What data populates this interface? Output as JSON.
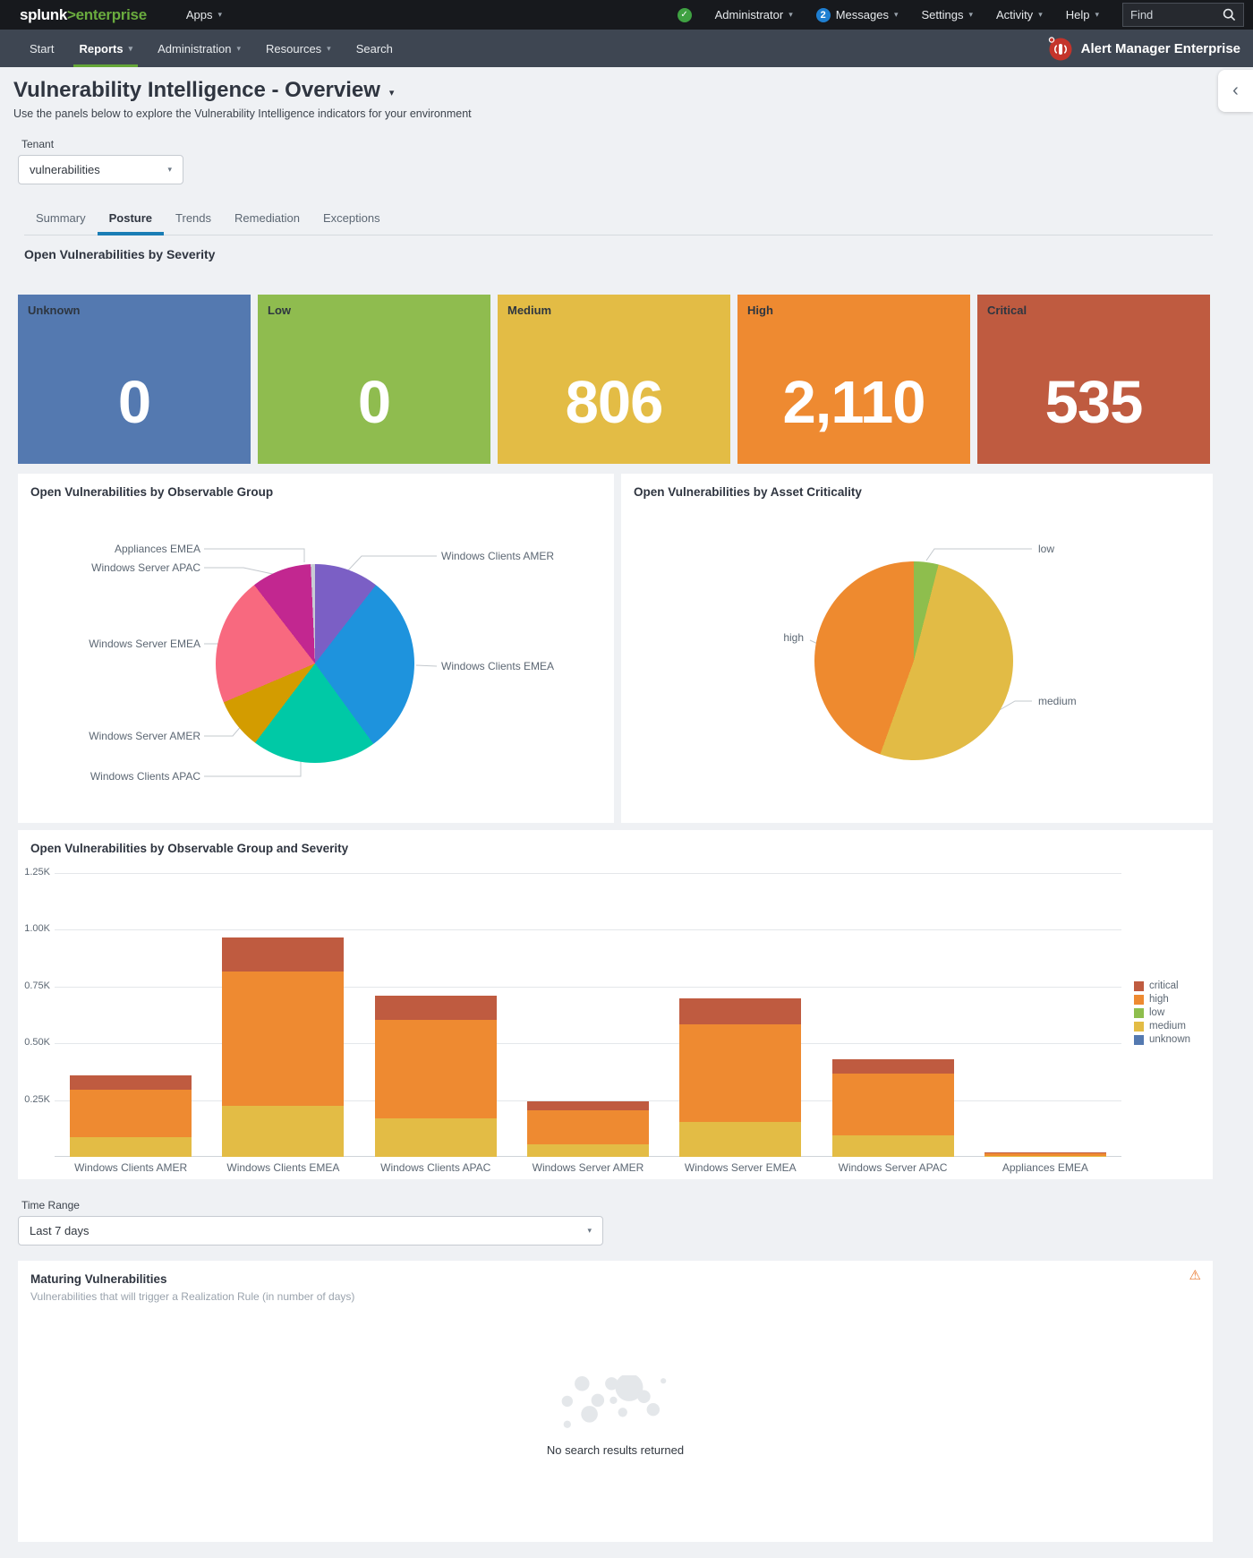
{
  "icons": {
    "caret_down": "▾",
    "chevron_left": "‹",
    "check": "✓",
    "warning": "⚠"
  },
  "topnav": {
    "logo_splunk": "splunk",
    "logo_gt": ">",
    "logo_product": "enterprise",
    "apps": "Apps",
    "administrator": "Administrator",
    "messages_badge": "2",
    "messages": "Messages",
    "settings": "Settings",
    "activity": "Activity",
    "help": "Help",
    "find_placeholder": "Find"
  },
  "appnav": {
    "items": [
      "Start",
      "Reports",
      "Administration",
      "Resources",
      "Search"
    ],
    "active": "Reports",
    "app_name": "Alert Manager Enterprise"
  },
  "page": {
    "title": "Vulnerability Intelligence - Overview",
    "subtitle": "Use the panels below to explore the Vulnerability Intelligence indicators for your environment",
    "tenant_label": "Tenant",
    "tenant_value": "vulnerabilities",
    "time_range_label": "Time Range",
    "time_range_value": "Last 7 days"
  },
  "tabs": {
    "items": [
      "Summary",
      "Posture",
      "Trends",
      "Remediation",
      "Exceptions"
    ],
    "active": "Posture"
  },
  "severity_section": {
    "heading": "Open Vulnerabilities by Severity",
    "tiles": [
      {
        "label": "Unknown",
        "value": "0",
        "color": "#5479b0"
      },
      {
        "label": "Low",
        "value": "0",
        "color": "#8fbc4f"
      },
      {
        "label": "Medium",
        "value": "806",
        "color": "#e3bc45"
      },
      {
        "label": "High",
        "value": "2,110",
        "color": "#ee8a31"
      },
      {
        "label": "Critical",
        "value": "535",
        "color": "#bf5b40"
      }
    ]
  },
  "chart_data": [
    {
      "type": "pie",
      "title": "Open Vulnerabilities by Observable Group",
      "legend_position": "callout-labels",
      "slices": [
        {
          "label": "Windows Clients AMER",
          "percent": 10.5,
          "color": "#7b5fc5"
        },
        {
          "label": "Windows Clients EMEA",
          "percent": 29.5,
          "color": "#1e93dd"
        },
        {
          "label": "Windows Clients APAC",
          "percent": 20.3,
          "color": "#00c9a6"
        },
        {
          "label": "Windows Server AMER",
          "percent": 8.3,
          "color": "#d39c00"
        },
        {
          "label": "Windows Server EMEA",
          "percent": 20.9,
          "color": "#f8697f"
        },
        {
          "label": "Windows Server APAC",
          "percent": 9.8,
          "color": "#c22790"
        },
        {
          "label": "Appliances EMEA",
          "percent": 0.7,
          "color": "#c8cdd4"
        }
      ]
    },
    {
      "type": "pie",
      "title": "Open Vulnerabilities by Asset Criticality",
      "legend_position": "callout-labels",
      "slices": [
        {
          "label": "low",
          "percent": 4.0,
          "color": "#8ebe4d"
        },
        {
          "label": "medium",
          "percent": 51.5,
          "color": "#e2bb45"
        },
        {
          "label": "high",
          "percent": 44.5,
          "color": "#ee8a2f"
        }
      ]
    },
    {
      "type": "stacked-bar",
      "title": "Open Vulnerabilities by Observable Group and Severity",
      "categories": [
        "Windows Clients AMER",
        "Windows Clients EMEA",
        "Windows Clients APAC",
        "Windows Server AMER",
        "Windows Server EMEA",
        "Windows Server APAC",
        "Appliances EMEA"
      ],
      "series": [
        {
          "name": "medium",
          "color": "#e3bc45",
          "values": [
            85,
            225,
            170,
            55,
            155,
            95,
            5
          ]
        },
        {
          "name": "high",
          "color": "#ee8a31",
          "values": [
            210,
            590,
            435,
            150,
            430,
            270,
            10
          ]
        },
        {
          "name": "critical",
          "color": "#bf5b40",
          "values": [
            65,
            150,
            105,
            40,
            115,
            65,
            5
          ]
        }
      ],
      "legend": [
        {
          "name": "critical",
          "color": "#bf5b40"
        },
        {
          "name": "high",
          "color": "#ee8a31"
        },
        {
          "name": "low",
          "color": "#8ebe4d"
        },
        {
          "name": "medium",
          "color": "#e3bc45"
        },
        {
          "name": "unknown",
          "color": "#5479b0"
        }
      ],
      "yticks": [
        {
          "label": "1.25K",
          "value": 1250
        },
        {
          "label": "1.00K",
          "value": 1000
        },
        {
          "label": "0.75K",
          "value": 750
        },
        {
          "label": "0.50K",
          "value": 500
        },
        {
          "label": "0.25K",
          "value": 250
        }
      ],
      "ylim": [
        0,
        1250
      ],
      "grid": true,
      "legend_position": "right"
    }
  ],
  "maturing": {
    "title": "Maturing Vulnerabilities",
    "subtitle": "Vulnerabilities that will trigger a Realization Rule (in number of days)",
    "empty_message": "No search results returned"
  }
}
